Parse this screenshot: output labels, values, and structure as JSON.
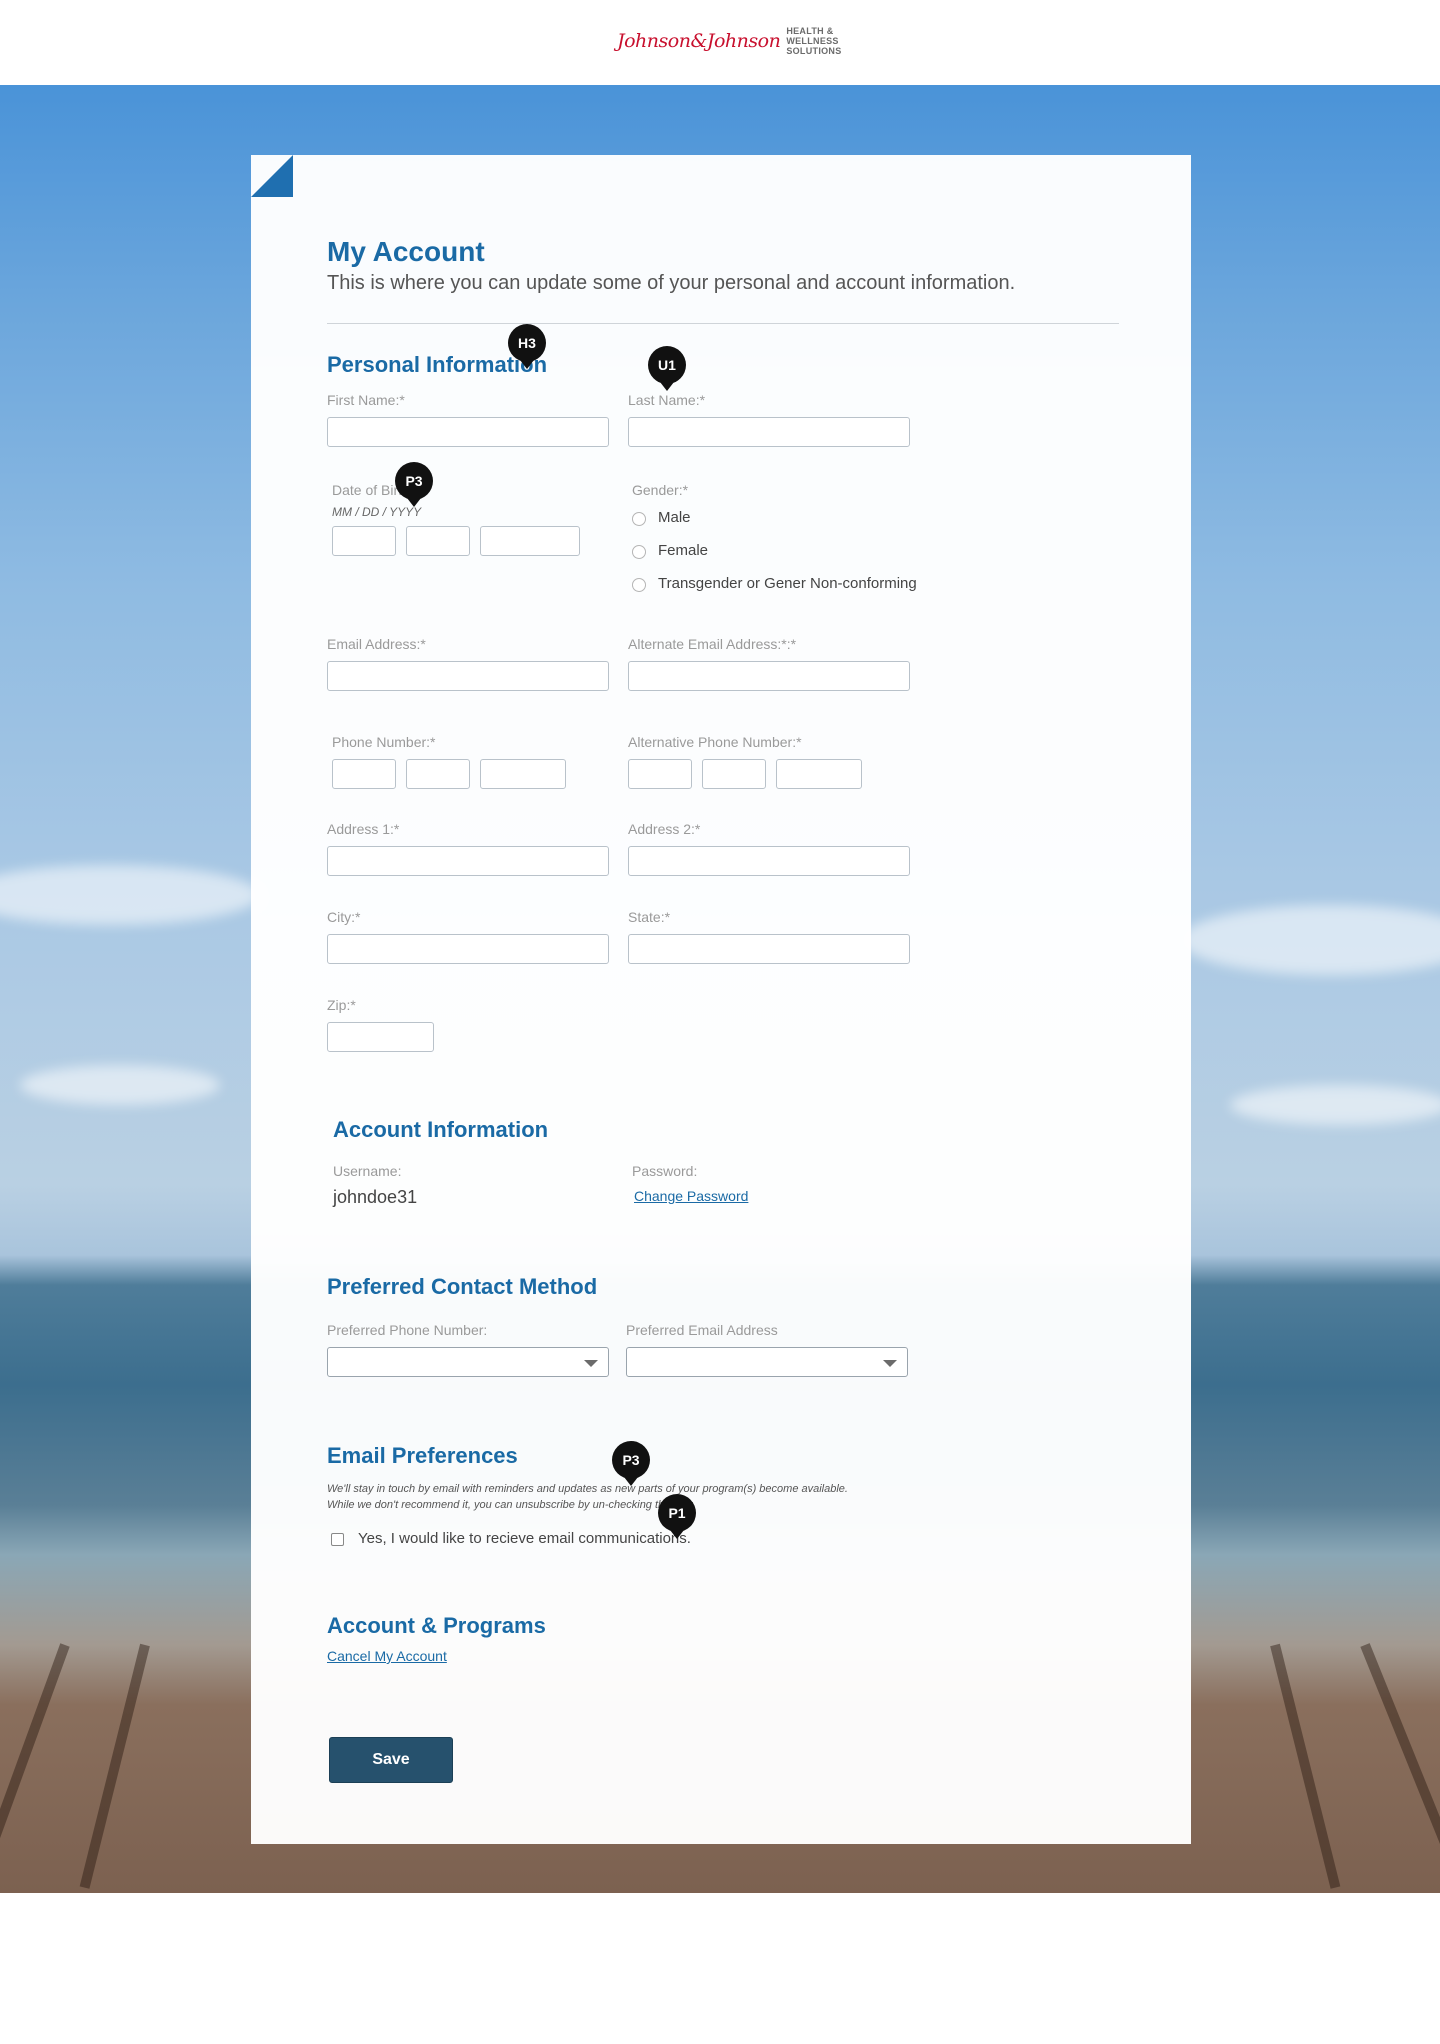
{
  "header": {
    "logo_script": "Johnson&Johnson",
    "logo_tag_line1": "HEALTH &",
    "logo_tag_line2": "WELLNESS",
    "logo_tag_line3": "SOLUTIONS"
  },
  "page": {
    "title": "My Account",
    "subtitle": "This is where you can update some of your personal and account information."
  },
  "personal": {
    "heading": "Personal Information",
    "first_name_label": "First Name:*",
    "last_name_label": "Last Name:*",
    "dob_label": "Date of Birth:*",
    "dob_hint": "MM / DD / YYYY",
    "gender_label": "Gender:*",
    "gender_options": [
      "Male",
      "Female",
      "Transgender or Gener Non-conforming"
    ],
    "email_label": "Email Address:*",
    "alt_email_label": "Alternate Email Address:*:*",
    "phone_label": "Phone Number:*",
    "alt_phone_label": "Alternative Phone Number:*",
    "address1_label": "Address 1:*",
    "address2_label": "Address 2:*",
    "city_label": "City:*",
    "state_label": "State:*",
    "zip_label": "Zip:*"
  },
  "account": {
    "heading": "Account Information",
    "username_label": "Username:",
    "username_value": "johndoe31",
    "password_label": "Password:",
    "change_password_link": "Change Password"
  },
  "contact": {
    "heading": "Preferred Contact Method",
    "phone_label": "Preferred Phone Number:",
    "email_label": "Preferred Email Address"
  },
  "email_prefs": {
    "heading": "Email Preferences",
    "note_line1": "We'll stay in touch by email with reminders and updates as new parts of your program(s) become available.",
    "note_line2": "While we don't recommend it, you can unsubscribe by un-checking this box.",
    "checkbox_label": "Yes, I would like to recieve email communications."
  },
  "programs": {
    "heading": "Account & Programs",
    "cancel_link": "Cancel My Account"
  },
  "actions": {
    "save_label": "Save"
  },
  "annotations": {
    "h3": "H3",
    "u1": "U1",
    "p3_dob": "P3",
    "p3_email": "P3",
    "p1": "P1"
  },
  "colors": {
    "accent": "#1a6aa5",
    "button": "#26516d",
    "logo_red": "#c8102e"
  }
}
